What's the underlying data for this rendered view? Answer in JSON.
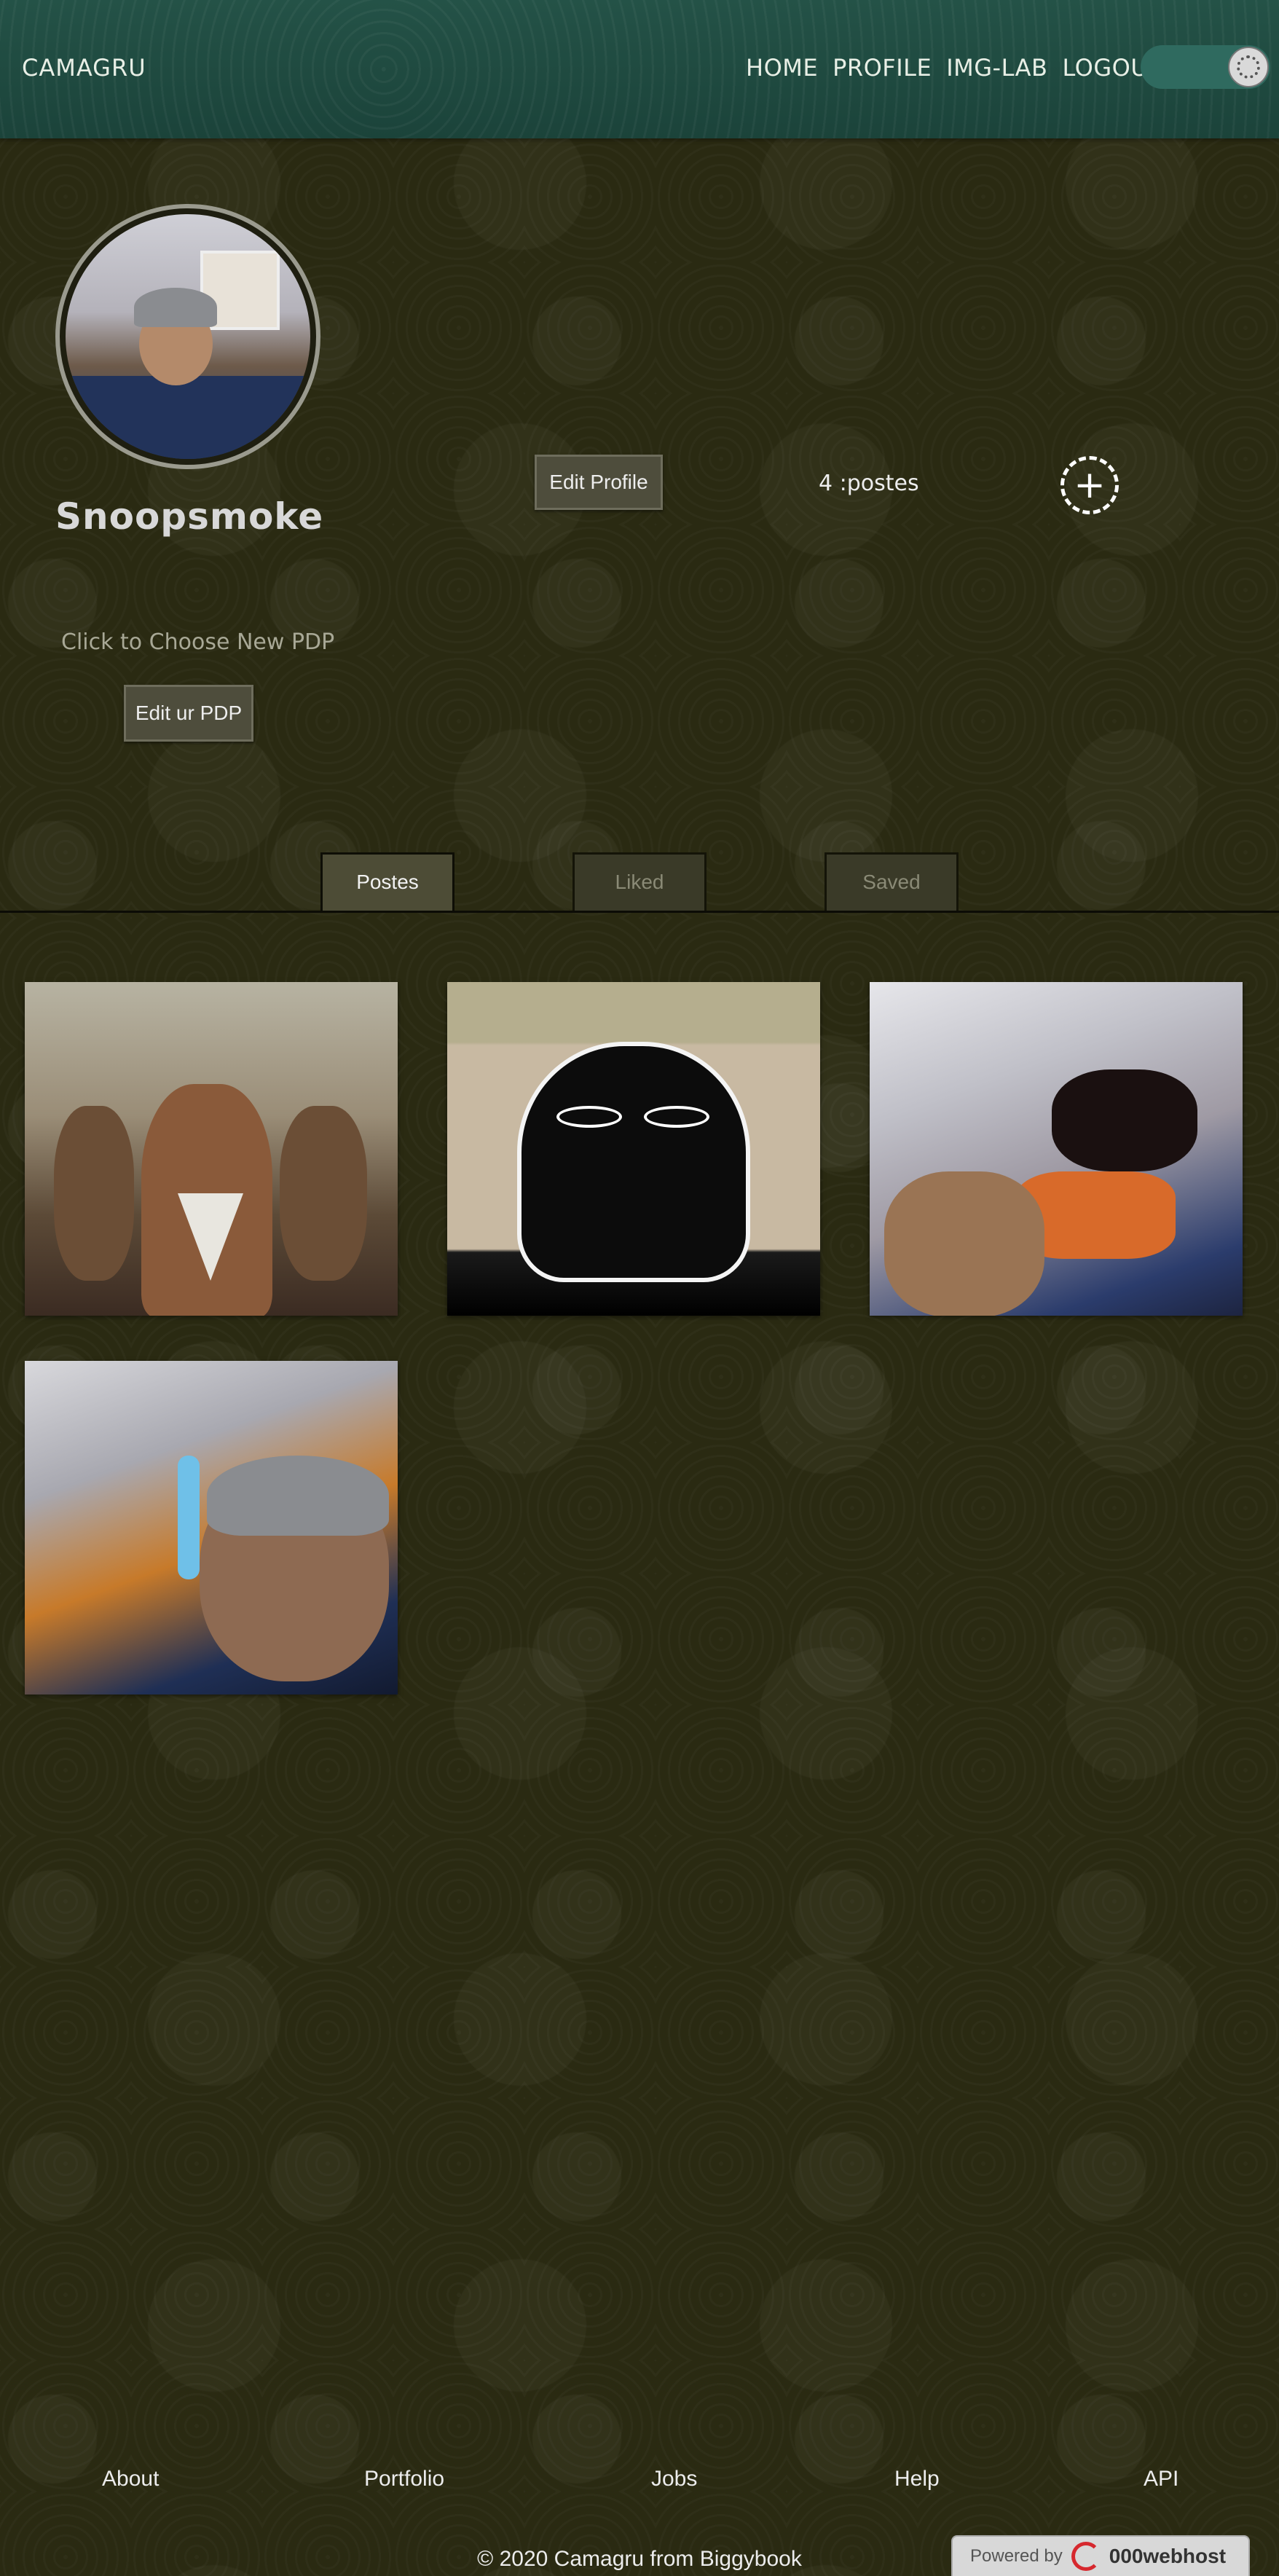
{
  "header": {
    "brand": "CAMAGRU",
    "nav": [
      "HOME",
      "PROFILE",
      "IMG-LAB",
      "LOGOUT"
    ],
    "theme_toggle_icon": "theme-toggle-icon"
  },
  "profile": {
    "username": "Snoopsmoke",
    "edit_profile_label": "Edit Profile",
    "posts_count": "4 :postes",
    "add_post_icon": "plus-circle-icon",
    "choose_pdp_text": "Click to Choose New PDP",
    "edit_pdp_label": "Edit ur PDP"
  },
  "tabs": [
    {
      "label": "Postes",
      "active": true
    },
    {
      "label": "Liked",
      "active": false
    },
    {
      "label": "Saved",
      "active": false
    }
  ],
  "posts": [
    {
      "thumb": "game-characters-selfie"
    },
    {
      "thumb": "cartoon-meme"
    },
    {
      "thumb": "bedroom-selfie"
    },
    {
      "thumb": "beanie-selfie"
    }
  ],
  "footer": {
    "links": [
      "About",
      "Portfolio",
      "Jobs",
      "Help",
      "API"
    ],
    "copyright": "© 2020 Camagru from Biggybook",
    "hosting_badge": {
      "prefix": "Powered by",
      "name": "000webhost",
      "accent": "#d6282e"
    }
  },
  "colors": {
    "header_bg": "#1f4a40",
    "page_bg": "#2a2a12",
    "button_bg": "#4e4d3c"
  }
}
